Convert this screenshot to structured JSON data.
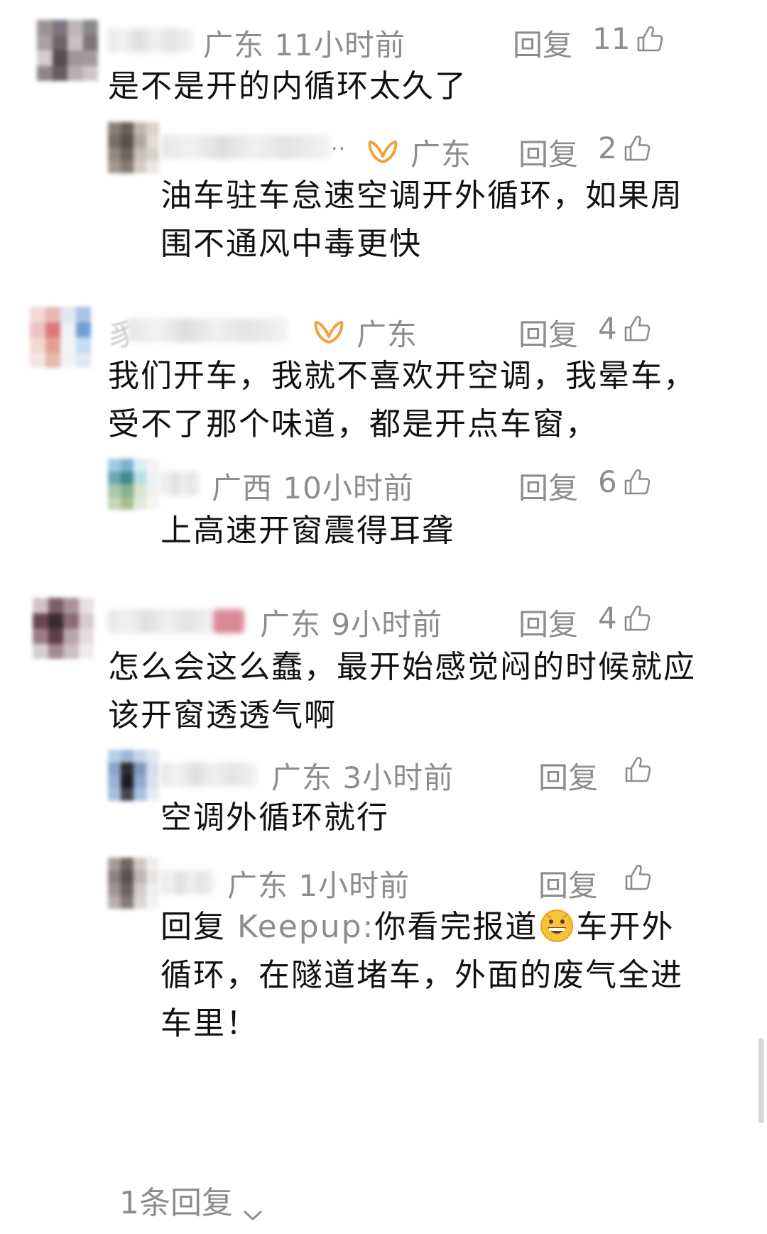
{
  "reply_label": "回复",
  "comments": [
    {
      "region": "广东",
      "time": "11小时前",
      "likes": "11",
      "text_lines": [
        "是不是开的内循环太久了"
      ],
      "avatar_colors": [
        "#9a9392",
        "#7d7480",
        "#bdb5b7",
        "#888",
        "#a8a0a2",
        "#6d6468",
        "#c9c1c2",
        "#7c7475",
        "#d3cdce",
        "#544d50",
        "#9e9698",
        "#a39b9c",
        "#8e8689",
        "#665d60",
        "#b7afb1",
        "#cfc8c9"
      ]
    },
    {
      "region": "广东",
      "likes": "2",
      "ellipsis": "..",
      "text_lines": [
        "油车驻车怠速空调开外循环，如果周",
        "围不通风中毒更快"
      ],
      "avatar_colors": [
        "#8a7f78",
        "#6b5f58",
        "#bfb7b0",
        "#d9d3ce",
        "#7a6d66",
        "#5a4f4a",
        "#b0a69f",
        "#e2ddd9",
        "#938880",
        "#6f635d",
        "#c7bfb8",
        "#d7d1cc",
        "#a39890",
        "#857a72",
        "#d3ccc6",
        "#ebe7e3"
      ]
    },
    {
      "region": "广东",
      "likes": "4",
      "name_char": "豸",
      "text_lines": [
        "我们开车，我就不喜欢开空调，我晕车，",
        "受不了那个味道，都是开点车窗，"
      ],
      "avatar_colors": [
        "#f1d9d8",
        "#e8b7b4",
        "#dfe9f3",
        "#a9c3e3",
        "#ecc4c2",
        "#d9797a",
        "#eef1f6",
        "#6e9fd6",
        "#f3d8cf",
        "#e59f90",
        "#f1f4f8",
        "#c6daf0",
        "#f4e4e0",
        "#e7b9b1",
        "#f3f3f3",
        "#dfe8f4"
      ]
    },
    {
      "region": "广西",
      "time": "10小时前",
      "likes": "6",
      "text_lines": [
        "上高速开窗震得耳聋"
      ],
      "avatar_colors": [
        "#9ecbe0",
        "#7fb4cf",
        "#d8eef5",
        "#f3f3f3",
        "#6fa7b5",
        "#3f8b8f",
        "#b9dde6",
        "#eef3f3",
        "#a8c6a9",
        "#8ab18c",
        "#d6e4cf",
        "#f1f2ef",
        "#c5d6b5",
        "#a7be93",
        "#e2e9d8",
        "#f5f5f5"
      ]
    },
    {
      "region": "广东",
      "time": "9小时前",
      "likes": "4",
      "text_lines": [
        "怎么会这么蠢，最开始感觉闷的时候就应",
        "该开窗透透气啊"
      ],
      "avatar_colors": [
        "#cfc3c6",
        "#7e5f68",
        "#a99398",
        "#e7e1e2",
        "#6a4651",
        "#3c2a31",
        "#8b6b74",
        "#d5cacd",
        "#9a7d84",
        "#5e3f48",
        "#b9a4aa",
        "#e3dcde",
        "#d8ced1",
        "#a08a90",
        "#cbbfc2",
        "#f0ecec"
      ]
    },
    {
      "region": "广东",
      "time": "3小时前",
      "text_lines": [
        "空调外循环就行"
      ],
      "avatar_colors": [
        "#b9cde6",
        "#9fb7d7",
        "#c6d5ea",
        "#e2e8f1",
        "#8aa5cb",
        "#2b2b30",
        "#7f97bd",
        "#d4deec",
        "#9cb2d5",
        "#1c1c20",
        "#90a9ce",
        "#dbe3ef",
        "#a9bedc",
        "#45464d",
        "#aac0de",
        "#e5ebf4"
      ]
    },
    {
      "region": "广东",
      "time": "1小时前",
      "mention": "Keepup:",
      "text_line1_a": "你看完报道",
      "text_line1_b": "车开外",
      "text_lines": [
        "循环，在隧道堵车，外面的废气全进",
        "车里！"
      ],
      "avatar_colors": [
        "#a39b98",
        "#6f6764",
        "#cfc9c6",
        "#eeeeee",
        "#8a817e",
        "#5a524f",
        "#bdb6b3",
        "#e7e4e2",
        "#9d9491",
        "#6b6360",
        "#d2ccca",
        "#efefef",
        "#b6afac",
        "#847b78",
        "#dcd7d5",
        "#f3f3f3"
      ]
    }
  ],
  "more_replies": "1条回复"
}
